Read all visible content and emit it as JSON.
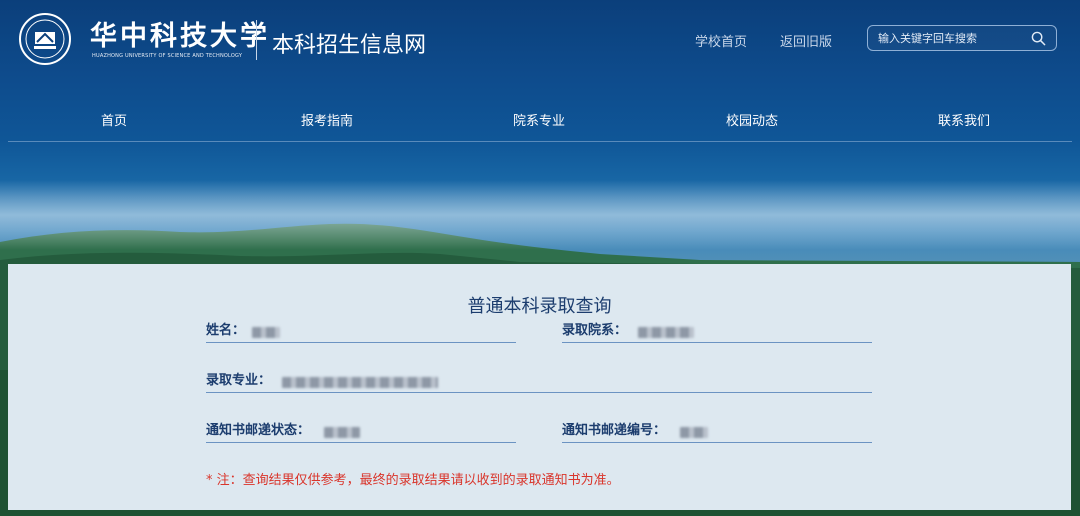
{
  "header": {
    "school_name": "华中科技大学",
    "school_name_en": "HUAZHONG UNIVERSITY OF SCIENCE AND TECHNOLOGY",
    "site_title": "本科招生信息网",
    "links": [
      "学校首页",
      "返回旧版"
    ],
    "search_placeholder": "输入关键字回车搜索",
    "search_value": "",
    "search_icon": "search-icon"
  },
  "nav": {
    "items": [
      "首页",
      "报考指南",
      "院系专业",
      "校园动态",
      "联系我们"
    ]
  },
  "query": {
    "title": "普通本科录取查询",
    "fields": {
      "name": {
        "label": "姓名：",
        "value": ""
      },
      "college": {
        "label": "录取院系：",
        "value": ""
      },
      "major": {
        "label": "录取专业：",
        "value": ""
      },
      "mail_status": {
        "label": "通知书邮递状态：",
        "value": ""
      },
      "mail_number": {
        "label": "通知书邮递编号：",
        "value": ""
      }
    },
    "note": "* 注：查询结果仅供参考，最终的录取结果请以收到的录取通知书为准。"
  },
  "colors": {
    "header_bg": "#0b3f7b",
    "panel_bg": "#dde8f0",
    "label": "#1c3d6e",
    "field_line": "#6b93c2",
    "note": "#d9352b"
  }
}
